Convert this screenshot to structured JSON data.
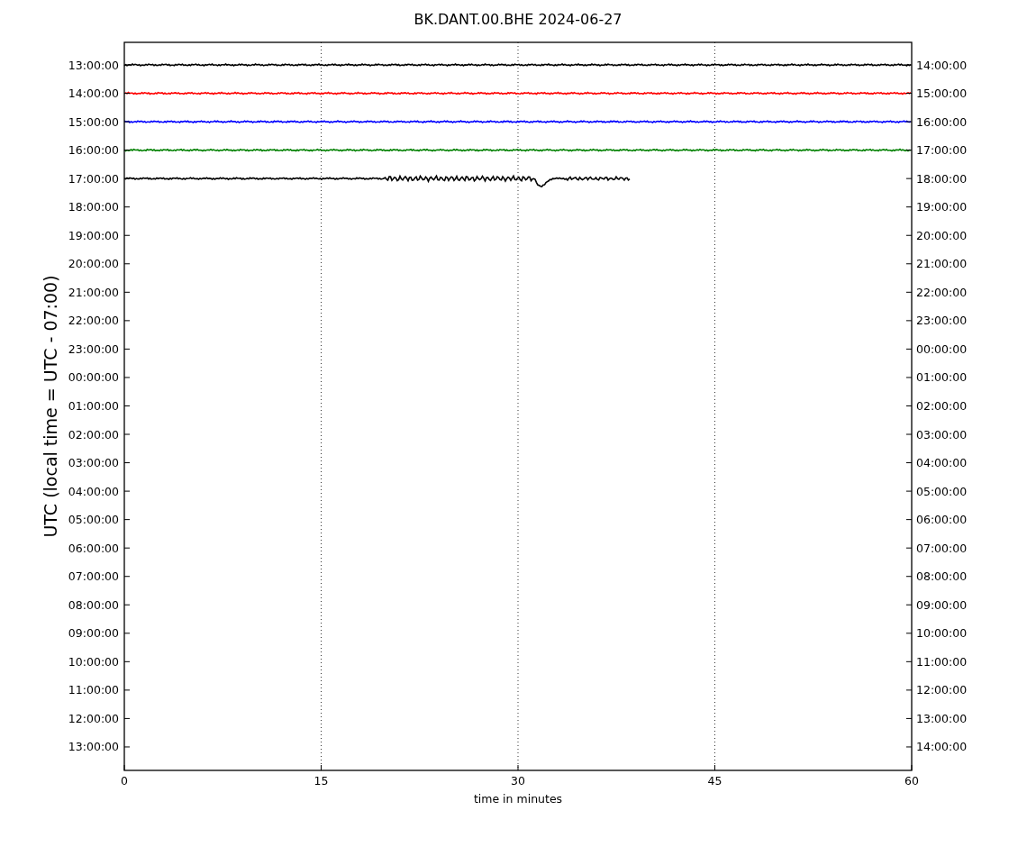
{
  "title": "BK.DANT.00.BHE 2024-06-27",
  "ylabel": "UTC (local time = UTC - 07:00)",
  "xlabel": "time in minutes",
  "xticks": [
    "0",
    "15",
    "30",
    "45",
    "60"
  ],
  "left_labels": [
    "13:00:00",
    "14:00:00",
    "15:00:00",
    "16:00:00",
    "17:00:00",
    "18:00:00",
    "19:00:00",
    "20:00:00",
    "21:00:00",
    "22:00:00",
    "23:00:00",
    "00:00:00",
    "01:00:00",
    "02:00:00",
    "03:00:00",
    "04:00:00",
    "05:00:00",
    "06:00:00",
    "07:00:00",
    "08:00:00",
    "09:00:00",
    "10:00:00",
    "11:00:00",
    "12:00:00",
    "13:00:00"
  ],
  "right_labels": [
    "14:00:00",
    "15:00:00",
    "16:00:00",
    "17:00:00",
    "18:00:00",
    "19:00:00",
    "20:00:00",
    "21:00:00",
    "22:00:00",
    "23:00:00",
    "00:00:00",
    "01:00:00",
    "02:00:00",
    "03:00:00",
    "04:00:00",
    "05:00:00",
    "06:00:00",
    "07:00:00",
    "08:00:00",
    "09:00:00",
    "10:00:00",
    "11:00:00",
    "12:00:00",
    "13:00:00",
    "14:00:00"
  ],
  "traces": [
    {
      "kind": "quiet",
      "color": "#000000",
      "level": 1
    },
    {
      "kind": "quiet",
      "color": "#ff0000",
      "level": 1
    },
    {
      "kind": "quiet",
      "color": "#0000ff",
      "level": 1
    },
    {
      "kind": "quiet",
      "color": "#008000",
      "level": 1
    },
    {
      "kind": "event",
      "color": "#000000",
      "level": 0.642
    }
  ]
}
